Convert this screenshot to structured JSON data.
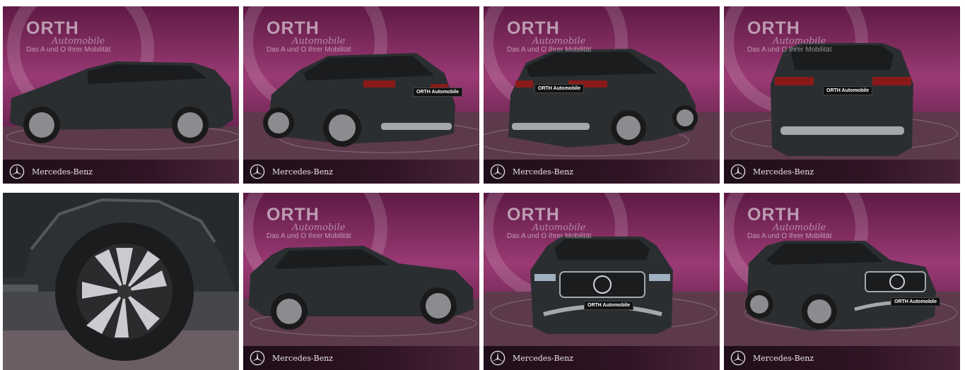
{
  "gallery": {
    "brand": {
      "logo_text": "ORTH",
      "script_text": "Automobile",
      "tagline": "Das A und O Ihrer Mobilität",
      "footer_label": "Mercedes-Benz",
      "plate_text": "ORTH Automobile"
    },
    "colors": {
      "backdrop": "#8a2a63",
      "floor": "#5a2a45",
      "car_body": "#2b2e31",
      "footer": "#1c0c16"
    },
    "images": [
      {
        "view": "side-left",
        "footer": true
      },
      {
        "view": "rear-left-three-quarter",
        "footer": true
      },
      {
        "view": "rear-right-three-quarter",
        "footer": true
      },
      {
        "view": "rear",
        "footer": true
      },
      {
        "view": "wheel-detail",
        "footer": false
      },
      {
        "view": "side-right",
        "footer": true
      },
      {
        "view": "front",
        "footer": true
      },
      {
        "view": "front-right-three-quarter",
        "footer": true
      }
    ]
  }
}
